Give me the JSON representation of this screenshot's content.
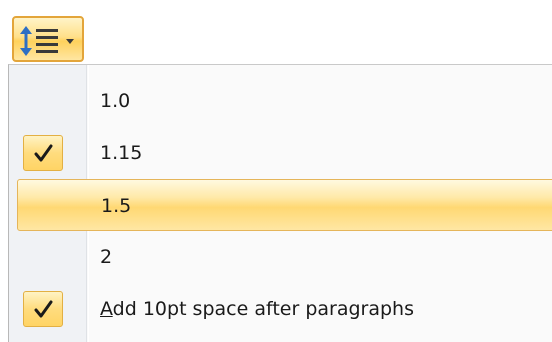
{
  "toolbar": {
    "button_icon": "line-paragraph-spacing-icon",
    "dropdown_icon": "chevron-down-icon"
  },
  "menu": {
    "items": [
      {
        "label": "1.0",
        "checked": false,
        "highlighted": false
      },
      {
        "label": "1.15",
        "checked": true,
        "highlighted": false
      },
      {
        "label": "1.5",
        "checked": false,
        "highlighted": true
      },
      {
        "label": "2",
        "checked": false,
        "highlighted": false
      }
    ],
    "add_space_after": {
      "accelerator": "A",
      "label_rest": "dd 10pt space after paragraphs",
      "checked": true
    }
  },
  "colors": {
    "accent_border": "#e3a53a",
    "highlight_fill": "#ffd873",
    "check_color": "#1a1a1a",
    "icon_arrow_blue": "#2d6fc4"
  }
}
